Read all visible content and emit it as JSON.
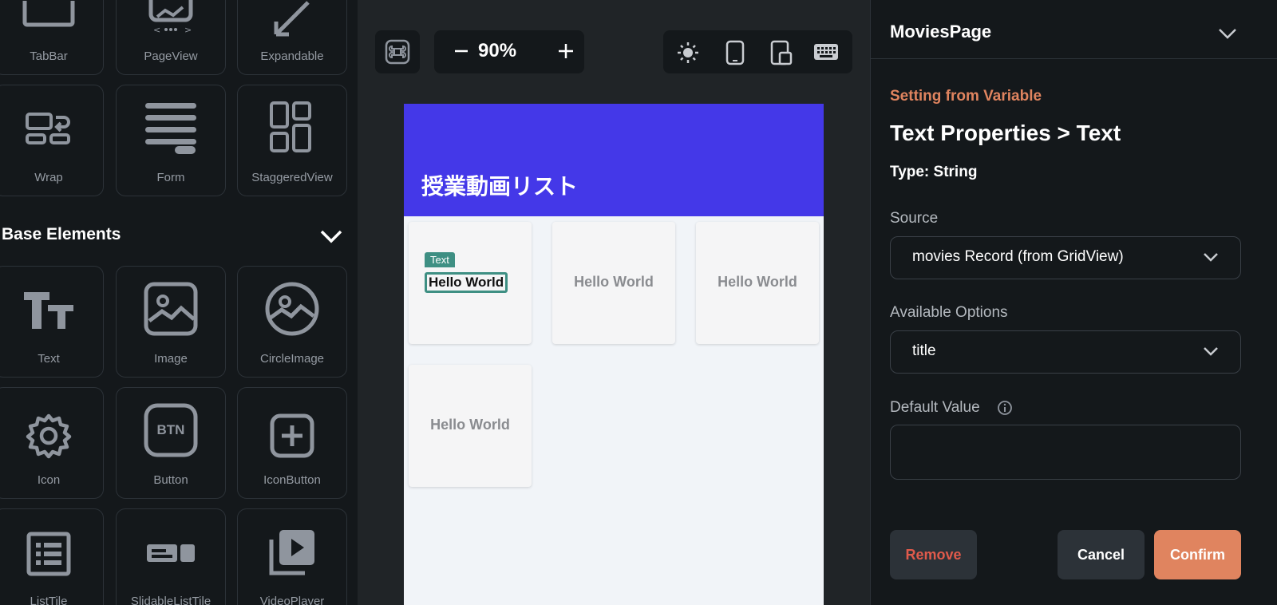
{
  "palette": {
    "tiles_top": [
      {
        "label": "TabBar",
        "icon": "tabbar-icon"
      },
      {
        "label": "PageView",
        "icon": "pageview-icon"
      },
      {
        "label": "Expandable",
        "icon": "expand-icon"
      },
      {
        "label": "Wrap",
        "icon": "wrap-icon"
      },
      {
        "label": "Form",
        "icon": "form-icon"
      },
      {
        "label": "StaggeredView",
        "icon": "staggered-icon"
      }
    ],
    "base_section_title": "Base Elements",
    "base_tiles": [
      {
        "label": "Text",
        "icon": "text-icon"
      },
      {
        "label": "Image",
        "icon": "image-icon"
      },
      {
        "label": "CircleImage",
        "icon": "circle-image-icon"
      },
      {
        "label": "Icon",
        "icon": "gear-icon"
      },
      {
        "label": "Button",
        "icon": "btn-icon",
        "icon_text": "BTN"
      },
      {
        "label": "IconButton",
        "icon": "plus-square-icon"
      },
      {
        "label": "ListTile",
        "icon": "list-icon"
      },
      {
        "label": "SlidableListTile",
        "icon": "slidable-icon"
      },
      {
        "label": "VideoPlayer",
        "icon": "video-icon"
      }
    ]
  },
  "toolbar": {
    "zoom": "90%"
  },
  "preview": {
    "appbar_title": "授業動画リスト",
    "appbar_color": "#4438e8",
    "selected_badge": "Text",
    "cards": [
      "Hello World",
      "Hello World",
      "Hello World",
      "Hello World"
    ]
  },
  "panel": {
    "page_name": "MoviesPage",
    "setting_label": "Setting from Variable",
    "heading": "Text Properties > Text",
    "type_label": "Type: String",
    "source_label": "Source",
    "source_value": "movies Record (from GridView)",
    "options_label": "Available Options",
    "options_value": "title",
    "default_label": "Default Value",
    "default_value": "",
    "remove_label": "Remove",
    "cancel_label": "Cancel",
    "confirm_label": "Confirm",
    "accent_color": "#e0845f"
  }
}
